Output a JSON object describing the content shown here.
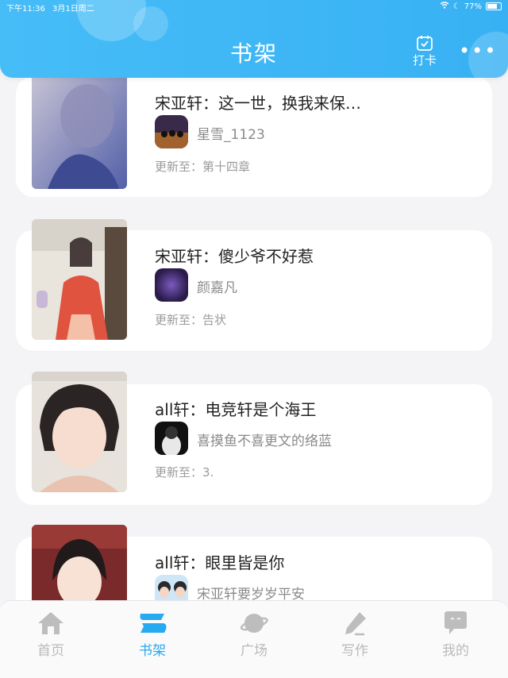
{
  "status_bar": {
    "time": "下午11:36",
    "date": "3月1日周二",
    "battery": "77%"
  },
  "header": {
    "title": "书架",
    "checkin_label": "打卡"
  },
  "books": [
    {
      "title": "宋亚轩：这一世，换我来保…",
      "author": "星雪_1123",
      "update": "更新至：第十四章"
    },
    {
      "title": "宋亚轩：傻少爷不好惹",
      "author": "颜嘉凡",
      "update": "更新至：告状"
    },
    {
      "title": "all轩：电竞轩是个海王",
      "author": "喜摸鱼不喜更文的络蓝",
      "update": "更新至：3."
    },
    {
      "title": "all轩：眼里皆是你",
      "author": "宋亚轩要岁岁平安",
      "update": ""
    }
  ],
  "tabs": [
    {
      "label": "首页",
      "icon": "home-icon"
    },
    {
      "label": "书架",
      "icon": "bookshelf-icon"
    },
    {
      "label": "广场",
      "icon": "planet-icon"
    },
    {
      "label": "写作",
      "icon": "pen-icon"
    },
    {
      "label": "我的",
      "icon": "chat-bubble-icon"
    }
  ],
  "colors": {
    "accent": "#25a9f0",
    "header": "#3fb6f5",
    "inactive": "#b9b9b9"
  }
}
